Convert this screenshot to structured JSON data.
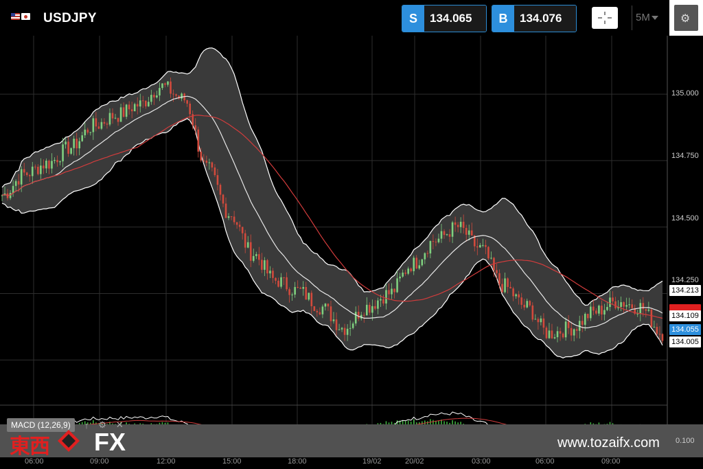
{
  "header": {
    "symbol": "USDJPY",
    "sell": {
      "tag": "S",
      "price": "134.065"
    },
    "buy": {
      "tag": "B",
      "price": "134.076"
    },
    "timeframe": "5M"
  },
  "chart": {
    "y_axis": [
      "135.000",
      "134.750",
      "134.500",
      "134.250"
    ],
    "y_axis_lower": "0.100",
    "x_axis": [
      "06:00",
      "09:00",
      "12:00",
      "15:00",
      "18:00",
      "19/02",
      "20/02",
      "03:00",
      "06:00",
      "09:00"
    ],
    "price_tags": {
      "upper_band": "134.213",
      "mid": "134.109",
      "bid": "134.055",
      "lower_band": "134.005"
    },
    "colors": {
      "bull": "#7fd07f",
      "bear": "#d24a3c",
      "ma": "#d23c3c",
      "band": "#ffffff",
      "accent": "#2d8fdd"
    }
  },
  "macd": {
    "label": "MACD (12,26,9)",
    "icons": [
      "up-arrow-icon",
      "gear-icon",
      "close-icon"
    ]
  },
  "brand": {
    "kanji": "東西",
    "fx": "FX",
    "site": "www.tozaifx.com"
  },
  "chart_data": {
    "type": "candlestick",
    "title": "USDJPY",
    "ylim": [
      133.83,
      135.22
    ],
    "x": [
      "06:00",
      "09:00",
      "12:00",
      "15:00",
      "18:00",
      "19/02",
      "20/02",
      "03:00",
      "06:00",
      "09:00"
    ],
    "series": [
      {
        "values": [
          134.62,
          134.7,
          134.74,
          134.8,
          134.88,
          134.92,
          134.96,
          135.03,
          134.98,
          134.72,
          134.55,
          134.4,
          134.3,
          134.26,
          134.2,
          134.12,
          134.2,
          134.25,
          134.36,
          134.45,
          134.5,
          134.42,
          134.28,
          134.2,
          134.1,
          134.12,
          134.18,
          134.22,
          134.2,
          134.1
        ]
      }
    ]
  }
}
